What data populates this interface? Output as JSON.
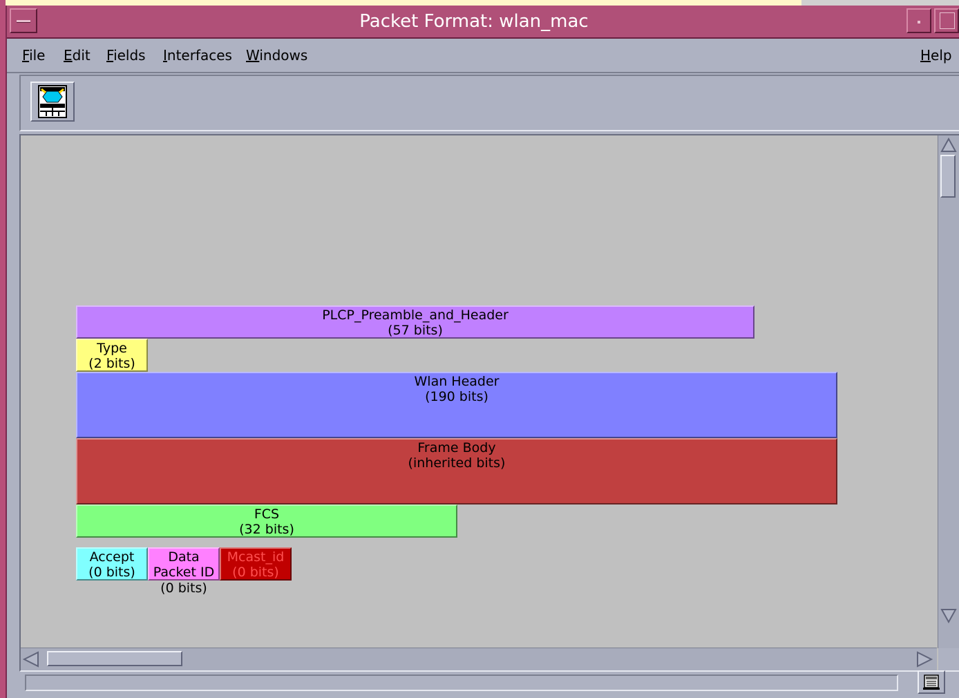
{
  "window": {
    "title": "Packet Format: wlan_mac"
  },
  "menubar": {
    "items": [
      {
        "label": "File"
      },
      {
        "label": "Edit"
      },
      {
        "label": "Fields"
      },
      {
        "label": "Interfaces"
      },
      {
        "label": "Windows"
      }
    ],
    "help_label": "Help"
  },
  "toolbar": {
    "icon": "packet-format-icon"
  },
  "fields": [
    {
      "name": "PLCP_Preamble_and_Header",
      "bits": "(57 bits)",
      "color": "#c080ff"
    },
    {
      "name": "Type",
      "bits": "(2 bits)",
      "color": "#ffff80"
    },
    {
      "name": "Wlan Header",
      "bits": "(190 bits)",
      "color": "#8080ff"
    },
    {
      "name": "Frame Body",
      "bits": "(inherited bits)",
      "color": "#c04040"
    },
    {
      "name": "FCS",
      "bits": "(32 bits)",
      "color": "#80ff80"
    }
  ],
  "interface_fields": [
    {
      "name": "Accept",
      "bits": "(0 bits)",
      "color": "#80ffff"
    },
    {
      "name": "Data Packet ID",
      "bits": "(0 bits)",
      "color": "#ff80ff"
    },
    {
      "name": "Mcast_id",
      "bits": "(0 bits)",
      "color": "#c00000"
    }
  ],
  "status": {
    "text": ""
  }
}
